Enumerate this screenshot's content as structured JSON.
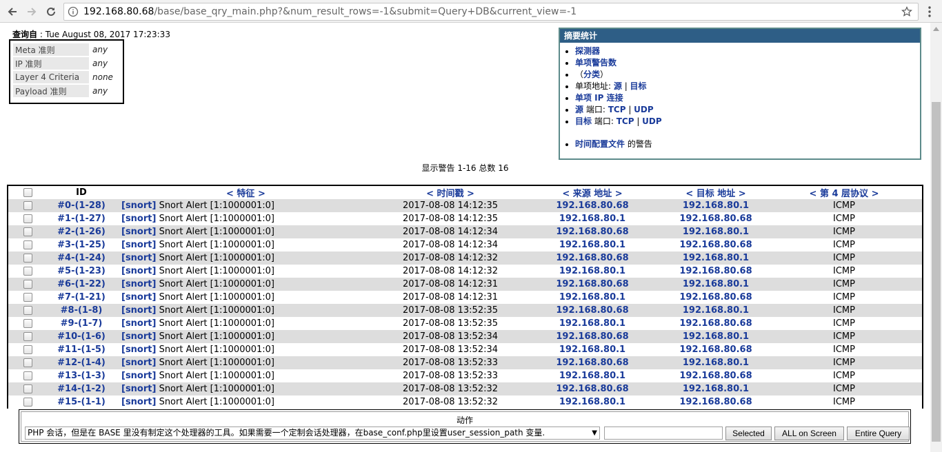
{
  "browser": {
    "url_host": "192.168.80.68",
    "url_rest": "/base/base_qry_main.php?&num_result_rows=-1&submit=Query+DB&current_view=-1"
  },
  "query": {
    "label": "查询自",
    "time": "Tue August 08, 2017 17:23:33"
  },
  "criteria": [
    {
      "label": "Meta 准则",
      "value": "any"
    },
    {
      "label": "IP 准则",
      "value": "any"
    },
    {
      "label": "Layer 4 Criteria",
      "value": "none"
    },
    {
      "label": "Payload 准则",
      "value": "any"
    }
  ],
  "summary": {
    "title": "摘要统计",
    "sensors": "探测器",
    "unique_alerts": "单项警告数",
    "classes_open": "（",
    "classes": "分类",
    "classes_close": "）",
    "unique_addr_label": "单项地址: ",
    "src": "源",
    "sep": " | ",
    "dst": "目标",
    "unique_ip_links": "单项 IP 连接",
    "src_port_prefix": "源",
    "port_label": " 端口: ",
    "tcp": "TCP",
    "udp": "UDP",
    "dst_port_prefix": "目标",
    "time_profile": "时间配置文件",
    "time_profile_suffix": " 的警告"
  },
  "display_count": "显示警告 1-16 总数 16",
  "table": {
    "headers": {
      "id": "ID",
      "signature": "< 特征 >",
      "timestamp": "< 时间戳 >",
      "src": "< 来源 地址 >",
      "dst": "< 目标 地址 >",
      "proto": "< 第 4 层协议 >"
    },
    "rows": [
      {
        "id": "#0-(1-28)",
        "sig_tag": "[snort]",
        "sig": " Snort Alert [1:1000001:0]",
        "time": "2017-08-08 14:12:35",
        "src": "192.168.80.68",
        "dst": "192.168.80.1",
        "proto": "ICMP"
      },
      {
        "id": "#1-(1-27)",
        "sig_tag": "[snort]",
        "sig": " Snort Alert [1:1000001:0]",
        "time": "2017-08-08 14:12:35",
        "src": "192.168.80.1",
        "dst": "192.168.80.68",
        "proto": "ICMP"
      },
      {
        "id": "#2-(1-26)",
        "sig_tag": "[snort]",
        "sig": " Snort Alert [1:1000001:0]",
        "time": "2017-08-08 14:12:34",
        "src": "192.168.80.68",
        "dst": "192.168.80.1",
        "proto": "ICMP"
      },
      {
        "id": "#3-(1-25)",
        "sig_tag": "[snort]",
        "sig": " Snort Alert [1:1000001:0]",
        "time": "2017-08-08 14:12:34",
        "src": "192.168.80.1",
        "dst": "192.168.80.68",
        "proto": "ICMP"
      },
      {
        "id": "#4-(1-24)",
        "sig_tag": "[snort]",
        "sig": " Snort Alert [1:1000001:0]",
        "time": "2017-08-08 14:12:32",
        "src": "192.168.80.68",
        "dst": "192.168.80.1",
        "proto": "ICMP"
      },
      {
        "id": "#5-(1-23)",
        "sig_tag": "[snort]",
        "sig": " Snort Alert [1:1000001:0]",
        "time": "2017-08-08 14:12:32",
        "src": "192.168.80.1",
        "dst": "192.168.80.68",
        "proto": "ICMP"
      },
      {
        "id": "#6-(1-22)",
        "sig_tag": "[snort]",
        "sig": " Snort Alert [1:1000001:0]",
        "time": "2017-08-08 14:12:31",
        "src": "192.168.80.68",
        "dst": "192.168.80.1",
        "proto": "ICMP"
      },
      {
        "id": "#7-(1-21)",
        "sig_tag": "[snort]",
        "sig": " Snort Alert [1:1000001:0]",
        "time": "2017-08-08 14:12:31",
        "src": "192.168.80.1",
        "dst": "192.168.80.68",
        "proto": "ICMP"
      },
      {
        "id": "#8-(1-8)",
        "sig_tag": "[snort]",
        "sig": " Snort Alert [1:1000001:0]",
        "time": "2017-08-08 13:52:35",
        "src": "192.168.80.68",
        "dst": "192.168.80.1",
        "proto": "ICMP"
      },
      {
        "id": "#9-(1-7)",
        "sig_tag": "[snort]",
        "sig": " Snort Alert [1:1000001:0]",
        "time": "2017-08-08 13:52:35",
        "src": "192.168.80.1",
        "dst": "192.168.80.68",
        "proto": "ICMP"
      },
      {
        "id": "#10-(1-6)",
        "sig_tag": "[snort]",
        "sig": " Snort Alert [1:1000001:0]",
        "time": "2017-08-08 13:52:34",
        "src": "192.168.80.68",
        "dst": "192.168.80.1",
        "proto": "ICMP"
      },
      {
        "id": "#11-(1-5)",
        "sig_tag": "[snort]",
        "sig": " Snort Alert [1:1000001:0]",
        "time": "2017-08-08 13:52:34",
        "src": "192.168.80.1",
        "dst": "192.168.80.68",
        "proto": "ICMP"
      },
      {
        "id": "#12-(1-4)",
        "sig_tag": "[snort]",
        "sig": " Snort Alert [1:1000001:0]",
        "time": "2017-08-08 13:52:33",
        "src": "192.168.80.68",
        "dst": "192.168.80.1",
        "proto": "ICMP"
      },
      {
        "id": "#13-(1-3)",
        "sig_tag": "[snort]",
        "sig": " Snort Alert [1:1000001:0]",
        "time": "2017-08-08 13:52:33",
        "src": "192.168.80.1",
        "dst": "192.168.80.68",
        "proto": "ICMP"
      },
      {
        "id": "#14-(1-2)",
        "sig_tag": "[snort]",
        "sig": " Snort Alert [1:1000001:0]",
        "time": "2017-08-08 13:52:32",
        "src": "192.168.80.68",
        "dst": "192.168.80.1",
        "proto": "ICMP"
      },
      {
        "id": "#15-(1-1)",
        "sig_tag": "[snort]",
        "sig": " Snort Alert [1:1000001:0]",
        "time": "2017-08-08 13:52:32",
        "src": "192.168.80.1",
        "dst": "192.168.80.68",
        "proto": "ICMP"
      }
    ]
  },
  "action": {
    "title": "动作",
    "select_value": "PHP 会话，但是在 BASE 里没有制定这个处理器的工具。如果需要一个定制会话处理器，在base_conf.php里设置user_session_path 变量.",
    "selected_btn": "Selected",
    "all_btn": "ALL on Screen",
    "entire_btn": "Entire Query"
  }
}
